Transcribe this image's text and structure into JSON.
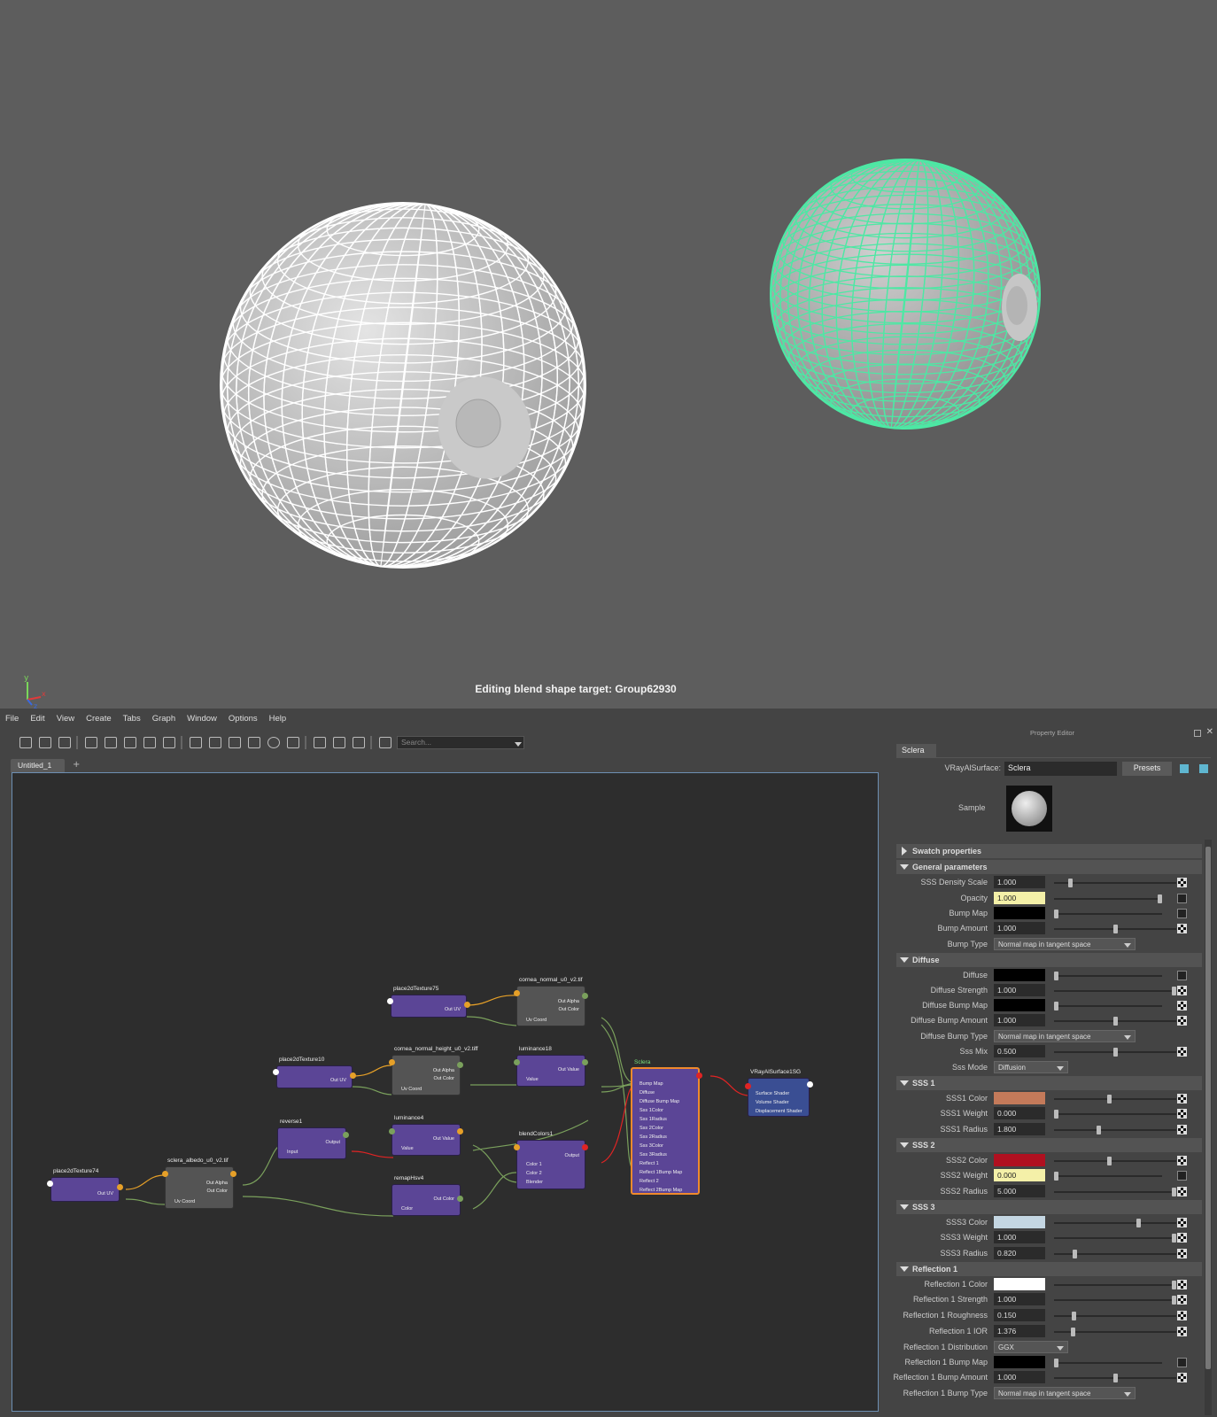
{
  "viewport": {
    "message": "Editing blend shape target: Group62930",
    "axis": {
      "x": "x",
      "y": "y",
      "z": "z"
    },
    "colors": {
      "background": "#5d5d5d",
      "wire_white": "#ffffff",
      "wire_selected": "#4de8a4"
    }
  },
  "menubar": [
    "File",
    "Edit",
    "View",
    "Create",
    "Tabs",
    "Graph",
    "Window",
    "Options",
    "Help"
  ],
  "toolbar": {
    "search_placeholder": "Search..."
  },
  "tabs": {
    "active": "Untitled_1",
    "add": "+"
  },
  "graph": {
    "nodes": {
      "p75": {
        "title": "place2dTexture75",
        "plugs": [
          "Out UV"
        ]
      },
      "cornea_n": {
        "title": "cornea_normal_u0_v2.tif",
        "plugs": [
          "Out Alpha",
          "Out Color",
          "Uv Coord"
        ]
      },
      "p10": {
        "title": "place2dTexture10",
        "plugs": [
          "Out UV"
        ]
      },
      "cornea_h": {
        "title": "cornea_normal_height_u0_v2.tiff",
        "plugs": [
          "Out Alpha",
          "Out Color",
          "Uv Coord"
        ]
      },
      "lum18": {
        "title": "luminance18",
        "plugs": [
          "Out Value",
          "Value"
        ]
      },
      "reverse1": {
        "title": "reverse1",
        "plugs": [
          "Output",
          "Input"
        ]
      },
      "lum4": {
        "title": "luminance4",
        "plugs": [
          "Out Value",
          "Value"
        ]
      },
      "blend1": {
        "title": "blendColors1",
        "plugs": [
          "Output",
          "Color 1",
          "Color 2",
          "Blender"
        ]
      },
      "p74": {
        "title": "place2dTexture74",
        "plugs": [
          "Out UV"
        ]
      },
      "albedo": {
        "title": "sclera_albedo_u0_v2.tif",
        "plugs": [
          "Out Alpha",
          "Out Color",
          "Uv Coord"
        ]
      },
      "remap4": {
        "title": "remapHsv4",
        "plugs": [
          "Out Color",
          "Color"
        ]
      },
      "sclera": {
        "title": "Sclera",
        "plugs": [
          "Bump Map",
          "Diffuse",
          "Diffuse Bump Map",
          "Sss 1Color",
          "Sss 1Radius",
          "Sss 2Color",
          "Sss 2Radius",
          "Sss 3Color",
          "Sss 3Radius",
          "Reflect 1",
          "Reflect 1Bump Map",
          "Reflect 2",
          "Reflect 2Bump Map"
        ]
      },
      "sg": {
        "title": "VRayAlSurface1SG",
        "plugs": [
          "Surface Shader",
          "Volume Shader",
          "Displacement Shader"
        ]
      }
    }
  },
  "property_editor": {
    "header": "Property Editor",
    "tab": "Sclera",
    "type_label": "VRayAlSurface:",
    "name_value": "Sclera",
    "presets": "Presets",
    "sample_label": "Sample",
    "sections": {
      "swatch": "Swatch properties",
      "general": "General parameters",
      "diffuse": "Diffuse",
      "sss1": "SSS 1",
      "sss2": "SSS 2",
      "sss3": "SSS 3",
      "refl1": "Reflection 1"
    },
    "rows": {
      "sss_density": {
        "label": "SSS Density Scale",
        "value": "1.000",
        "level": 0.12
      },
      "opacity": {
        "label": "Opacity",
        "value": "1.000",
        "level": 1.0,
        "color": "#f4f0a8"
      },
      "bump_map": {
        "label": "Bump Map",
        "color": "#000000"
      },
      "bump_amount": {
        "label": "Bump Amount",
        "value": "1.000",
        "level": 0.5
      },
      "bump_type": {
        "label": "Bump Type",
        "value": "Normal map in tangent space"
      },
      "diffuse": {
        "label": "Diffuse",
        "color": "#000000"
      },
      "diffuse_strength": {
        "label": "Diffuse Strength",
        "value": "1.000",
        "level": 1.0
      },
      "diffuse_bump_map": {
        "label": "Diffuse Bump Map",
        "color": "#000000"
      },
      "diffuse_bump_amount": {
        "label": "Diffuse Bump Amount",
        "value": "1.000",
        "level": 0.5
      },
      "diffuse_bump_type": {
        "label": "Diffuse Bump Type",
        "value": "Normal map in tangent space"
      },
      "sss_mix": {
        "label": "Sss Mix",
        "value": "0.500",
        "level": 0.5
      },
      "sss_mode": {
        "label": "Sss Mode",
        "value": "Diffusion"
      },
      "sss1_color": {
        "label": "SSS1 Color",
        "color": "#c47a5a",
        "level": 0.45
      },
      "sss1_weight": {
        "label": "SSS1 Weight",
        "value": "0.000",
        "level": 0.0
      },
      "sss1_radius": {
        "label": "SSS1 Radius",
        "value": "1.800",
        "level": 0.36
      },
      "sss2_color": {
        "label": "SSS2 Color",
        "color": "#b01020",
        "level": 0.45
      },
      "sss2_weight": {
        "label": "SSS2 Weight",
        "value": "0.000",
        "level": 0.0,
        "color": "#f4f0a8"
      },
      "sss2_radius": {
        "label": "SSS2 Radius",
        "value": "5.000",
        "level": 1.0
      },
      "sss3_color": {
        "label": "SSS3 Color",
        "color": "#c4d6e2",
        "level": 0.7
      },
      "sss3_weight": {
        "label": "SSS3 Weight",
        "value": "1.000",
        "level": 1.0
      },
      "sss3_radius": {
        "label": "SSS3 Radius",
        "value": "0.820",
        "level": 0.16
      },
      "refl1_color": {
        "label": "Reflection 1 Color",
        "color": "#ffffff",
        "level": 1.0
      },
      "refl1_strength": {
        "label": "Reflection 1 Strength",
        "value": "1.000",
        "level": 1.0
      },
      "refl1_roughness": {
        "label": "Reflection 1 Roughness",
        "value": "0.150",
        "level": 0.15
      },
      "refl1_ior": {
        "label": "Reflection 1 IOR",
        "value": "1.376",
        "level": 0.14
      },
      "refl1_dist": {
        "label": "Reflection 1 Distribution",
        "value": "GGX"
      },
      "refl1_bump_map": {
        "label": "Reflection 1 Bump Map",
        "color": "#000000"
      },
      "refl1_bump_amount": {
        "label": "Reflection 1 Bump Amount",
        "value": "1.000",
        "level": 0.5
      },
      "refl1_bump_type": {
        "label": "Reflection 1 Bump Type",
        "value": "Normal map in tangent space"
      }
    }
  }
}
